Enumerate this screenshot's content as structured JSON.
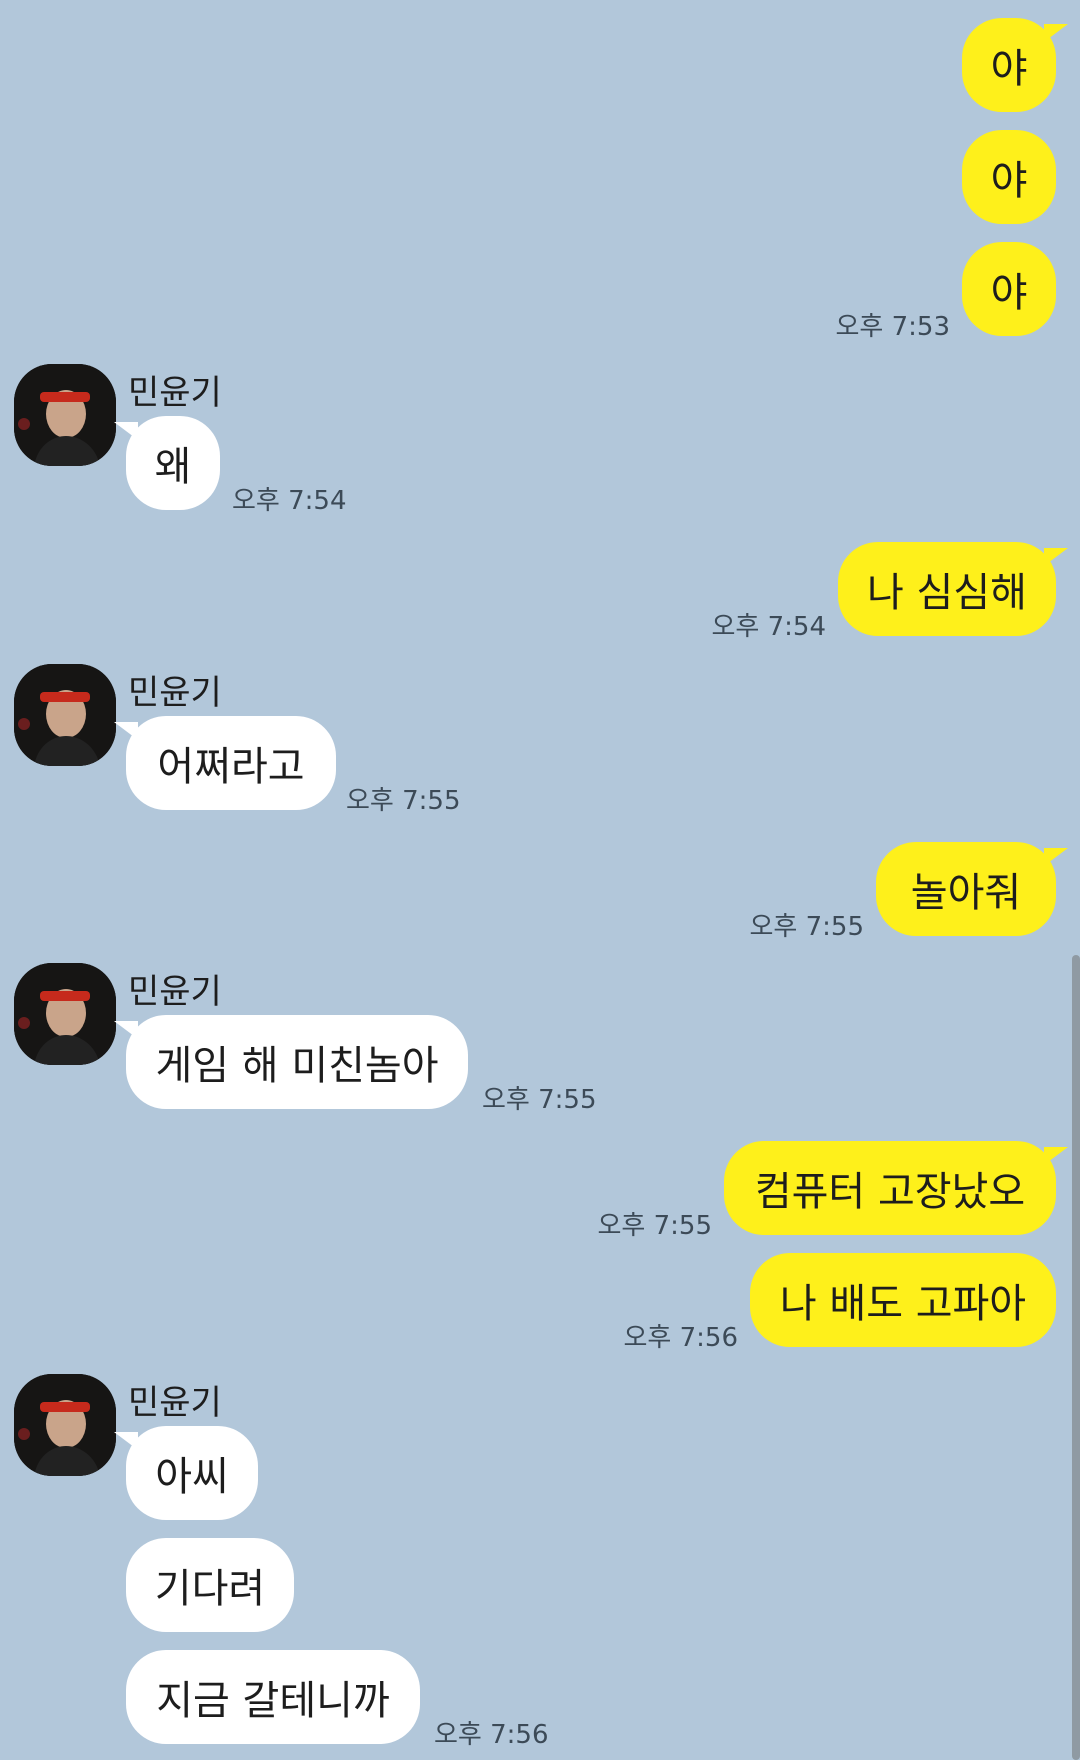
{
  "contact": {
    "name": "민윤기",
    "avatar_icon": "profile-photo"
  },
  "colors": {
    "background": "#b2c7da",
    "my_bubble": "#fef01b",
    "their_bubble": "#ffffff"
  },
  "messages": [
    {
      "from": "me",
      "text": "야"
    },
    {
      "from": "me",
      "text": "야"
    },
    {
      "from": "me",
      "text": "야",
      "time": "오후 7:53"
    },
    {
      "from": "them",
      "text": "왜",
      "time": "오후 7:54"
    },
    {
      "from": "me",
      "text": "나 심심해",
      "time": "오후 7:54"
    },
    {
      "from": "them",
      "text": "어쩌라고",
      "time": "오후 7:55"
    },
    {
      "from": "me",
      "text": "놀아줘",
      "time": "오후 7:55"
    },
    {
      "from": "them",
      "text": "게임 해 미친놈아",
      "time": "오후 7:55"
    },
    {
      "from": "me",
      "text": "컴퓨터 고장났오",
      "time": "오후 7:55"
    },
    {
      "from": "me",
      "text": "나 배도 고파아",
      "time": "오후 7:56"
    },
    {
      "from": "them",
      "text": "아씨"
    },
    {
      "from": "them",
      "text": "기다려"
    },
    {
      "from": "them",
      "text": "지금 갈테니까",
      "time": "오후 7:56"
    }
  ]
}
